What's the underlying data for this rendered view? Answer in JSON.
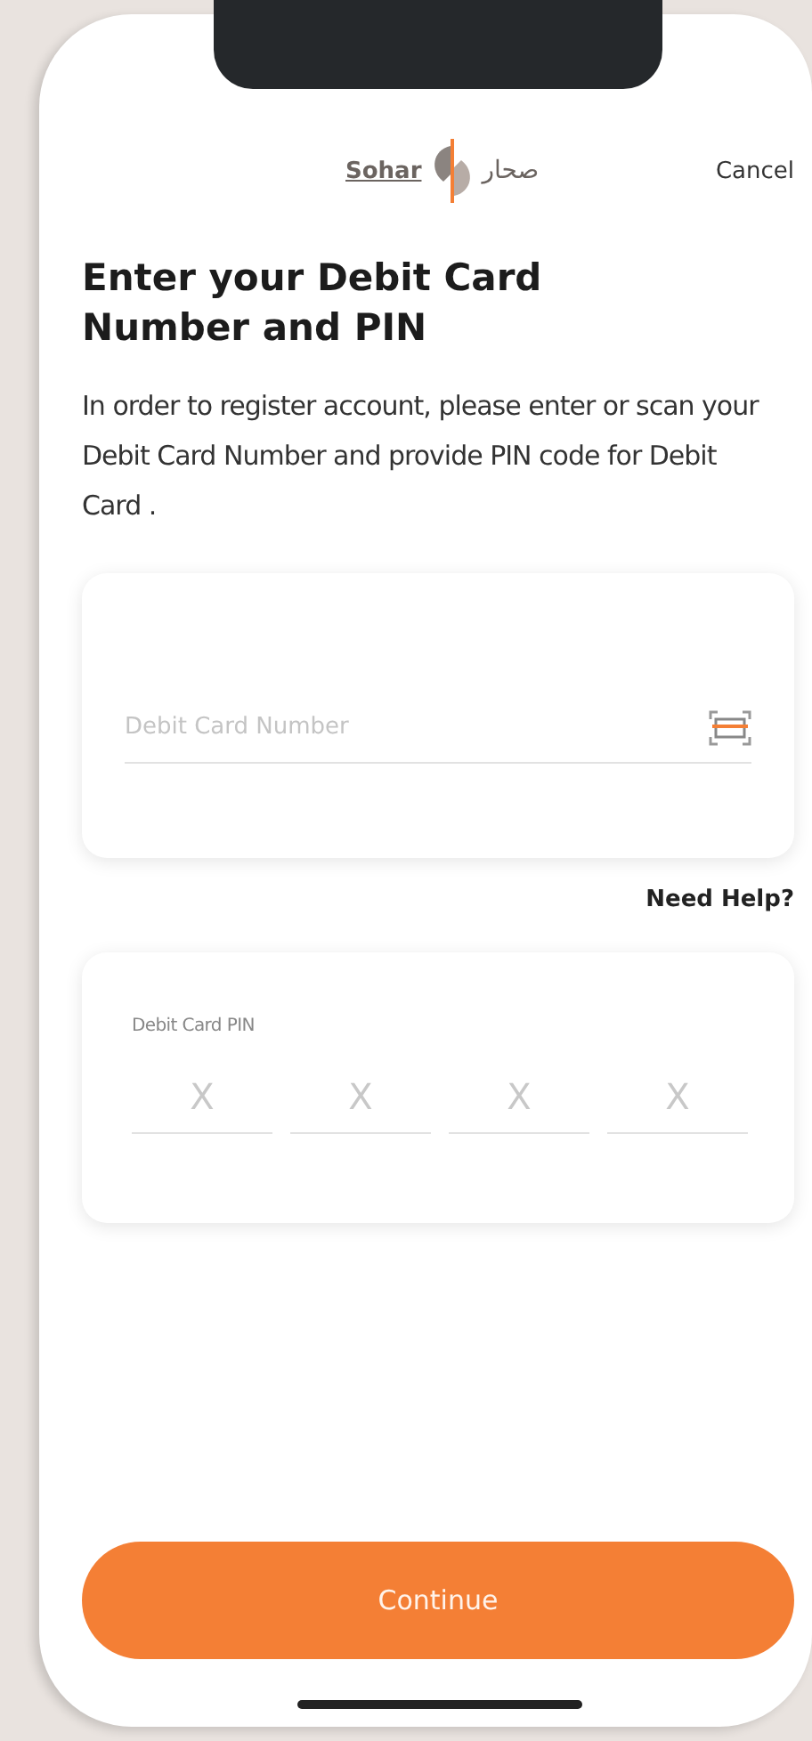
{
  "header": {
    "logo_latin": "Sohar",
    "logo_arabic": "صحار",
    "cancel": "Cancel"
  },
  "title": "Enter your Debit Card Number and PIN",
  "description": "In order to register account, please enter or scan your Debit Card Number and provide PIN code for Debit Card .",
  "card_number": {
    "placeholder": "Debit Card Number"
  },
  "help_link": "Need Help?",
  "pin": {
    "label": "Debit Card PIN",
    "digits": [
      {
        "placeholder": "X"
      },
      {
        "placeholder": "X"
      },
      {
        "placeholder": "X"
      },
      {
        "placeholder": "X"
      }
    ]
  },
  "continue_button": "Continue"
}
